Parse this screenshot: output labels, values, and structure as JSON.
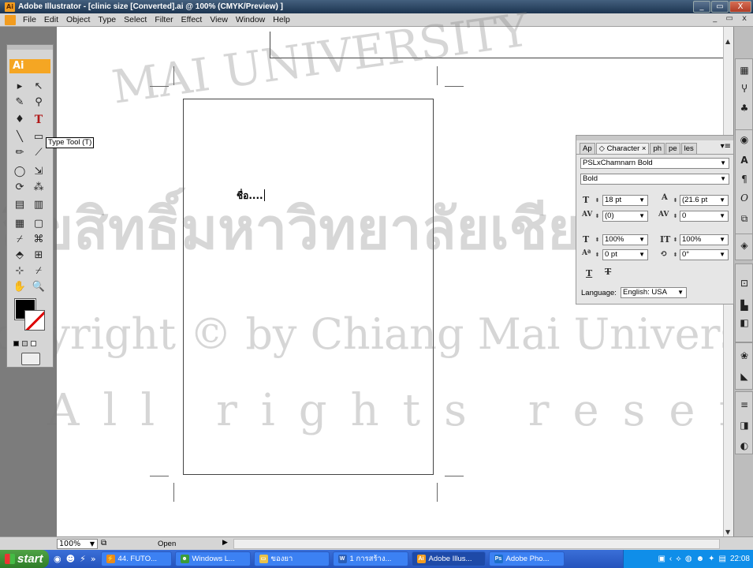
{
  "window": {
    "title": "Adobe Illustrator - [clinic size [Converted].ai @ 100% (CMYK/Preview) ]",
    "app_badge": "Ai",
    "controls": [
      "_",
      "▭",
      "X"
    ]
  },
  "menubar": {
    "items": [
      "File",
      "Edit",
      "Object",
      "Type",
      "Select",
      "Filter",
      "Effect",
      "View",
      "Window",
      "Help"
    ],
    "doc_controls": "_ ▭ x"
  },
  "toolbox": {
    "logo": "Ai",
    "tooltip": "Type Tool (T)",
    "tools": [
      "▸",
      "↖",
      "✎",
      "⚲",
      "♦",
      "T",
      "╲",
      "▭",
      "✏",
      "⟋",
      "◯",
      "⇲",
      "⟳",
      "⁂",
      "▤",
      "▥",
      "▦",
      "▢",
      "⌿",
      "⌘",
      "⬘",
      "⊞",
      "⊹",
      "⌿",
      "✋",
      "🔍"
    ]
  },
  "document": {
    "text": "ชื่อ....",
    "colors": {
      "fill": "#000000",
      "stroke_none": "#dd0000"
    }
  },
  "watermarks": {
    "line1": "MAI UNIVERSITY",
    "line2": "ลิขสิทธิ์มหาวิทยาลัยเชียงใหม่",
    "line3": "Copyright © by Chiang Mai University",
    "line4": "All rights reserved"
  },
  "character_panel": {
    "tabs": [
      "Ap",
      "◇ Character ×",
      "ph",
      "pe",
      "les"
    ],
    "font_family": "PSLxChamnarn Bold",
    "font_style": "Bold",
    "font_size": "18 pt",
    "leading": "(21.6 pt",
    "kerning": "(0)",
    "tracking": "0",
    "vertical_scale": "100%",
    "horizontal_scale": "100%",
    "baseline_shift": "0 pt",
    "rotation": "0°",
    "language_label": "Language:",
    "language": "English: USA"
  },
  "statusbar": {
    "zoom": "100%",
    "status": "Open"
  },
  "taskbar": {
    "start": "start",
    "tasks": [
      "44. FUTO...",
      "Windows L...",
      "ของยา",
      "1 การสร้าง...",
      "Adobe Illus...",
      "Adobe Pho..."
    ],
    "clock": "22:08"
  }
}
